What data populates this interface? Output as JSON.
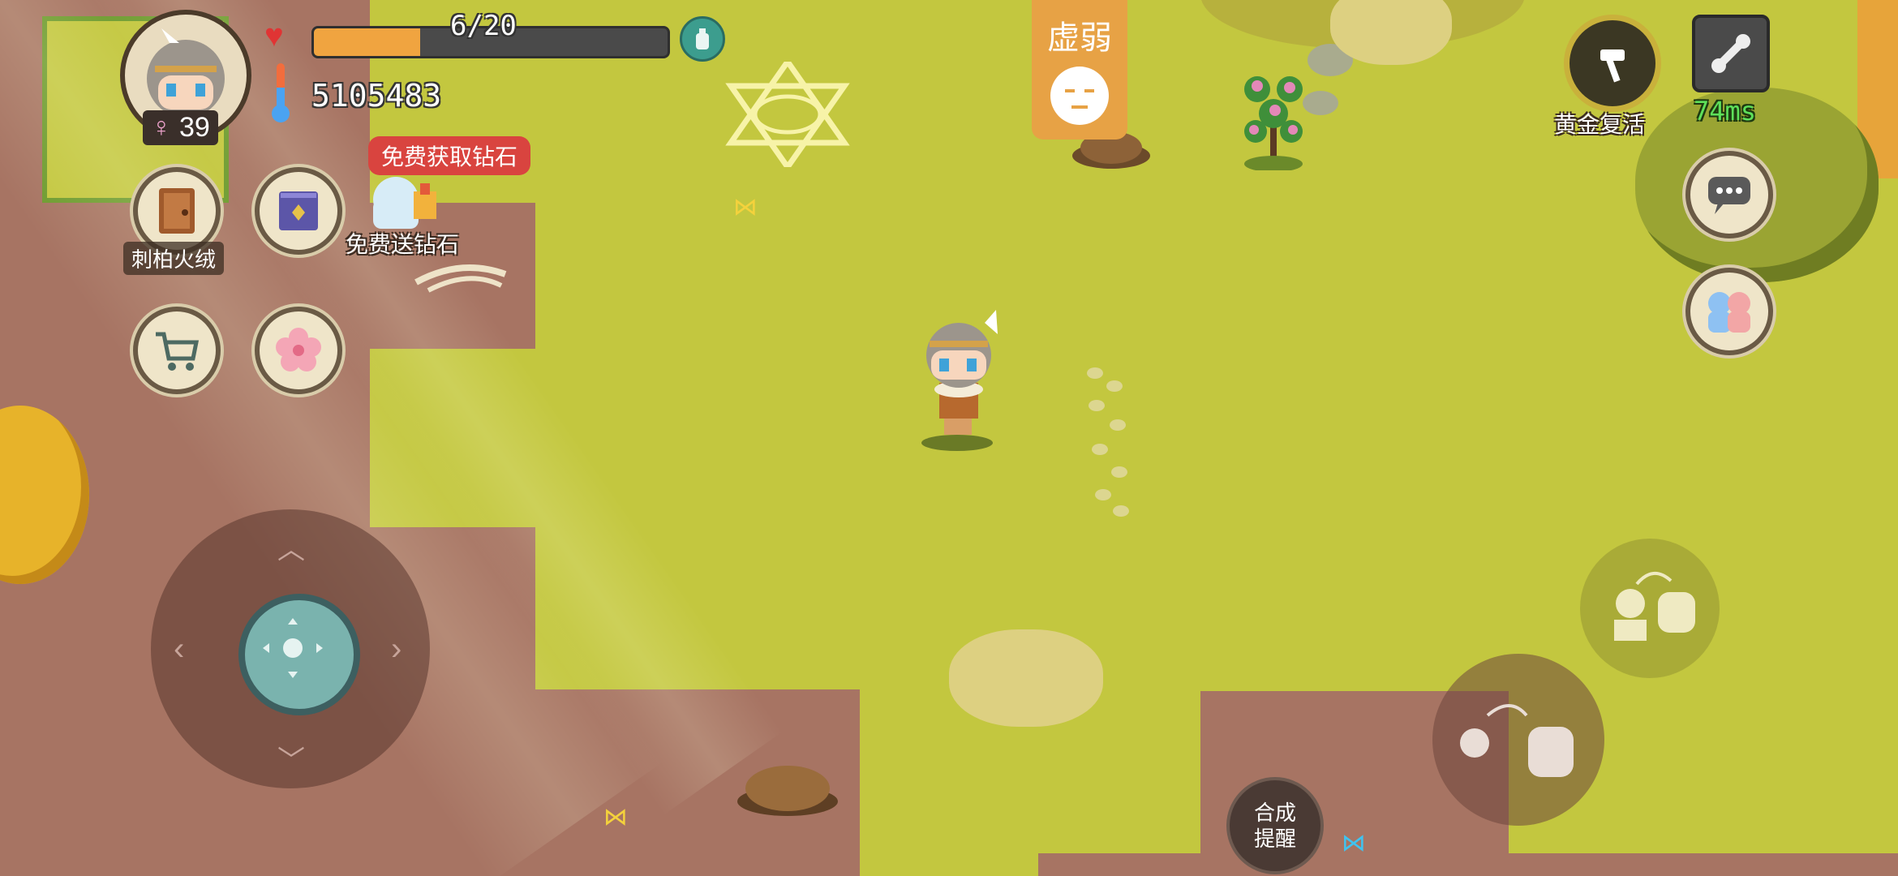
{
  "player": {
    "level": "39",
    "gender_icon": "female-symbol-icon",
    "hp_current": 6,
    "hp_max": 20,
    "hp_text": "6/20",
    "temperature": "5105483"
  },
  "status": {
    "condition": "虚弱"
  },
  "buttons": {
    "item_juniper": "刺柏火绒",
    "free_diamonds_banner": "免费获取钻石",
    "free_diamonds_gift": "免费送钻石",
    "golden_revive": "黄金复活",
    "craft_line1": "合成",
    "craft_line2": "提醒"
  },
  "network": {
    "ping": "74ms"
  },
  "colors": {
    "grass": "#c3c73f",
    "dirt": "#a77463",
    "hp_fill": "#f0a440",
    "ping_green": "#5ee05a",
    "weak_badge": "#e7a245"
  }
}
